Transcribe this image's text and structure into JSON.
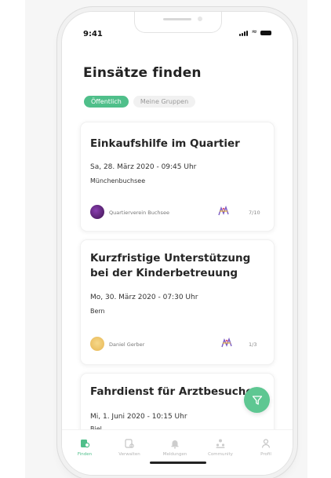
{
  "status_bar": {
    "time": "9:41"
  },
  "header": {
    "title": "Einsätze finden"
  },
  "tabs": [
    {
      "label": "Öffentlich",
      "active": true
    },
    {
      "label": "Meine Gruppen",
      "active": false
    }
  ],
  "cards": [
    {
      "title_lines": [
        "Einkaufshilfe im Quartier"
      ],
      "date": "Sa, 28. März 2020 - 09:45 Uhr",
      "place": "Münchenbuchsee",
      "organizer": "Quartierverein Buchsee",
      "count": "7/10"
    },
    {
      "title_lines": [
        "Kurzfristige Unterstützung",
        "bei der Kinderbetreuung"
      ],
      "date": "Mo, 30. März 2020 - 07:30 Uhr",
      "place": "Bern",
      "organizer": "Daniel Gerber",
      "count": "1/3"
    },
    {
      "title_lines": [
        "Fahrdienst für Arztbesuche"
      ],
      "date": "Mi, 1. Juni 2020 - 10:15 Uhr",
      "place": "Biel"
    }
  ],
  "bottom_nav": [
    {
      "label": "Finden",
      "icon": "search-task-icon",
      "active": true
    },
    {
      "label": "Verwalten",
      "icon": "manage-icon",
      "active": false
    },
    {
      "label": "Meldungen",
      "icon": "bell-icon",
      "active": false
    },
    {
      "label": "Community",
      "icon": "community-icon",
      "active": false
    },
    {
      "label": "Profil",
      "icon": "profile-icon",
      "active": false
    }
  ],
  "colors": {
    "accent": "#4fbf8a",
    "fab": "#5ec792",
    "skill_mark": "#7b5cc4"
  }
}
